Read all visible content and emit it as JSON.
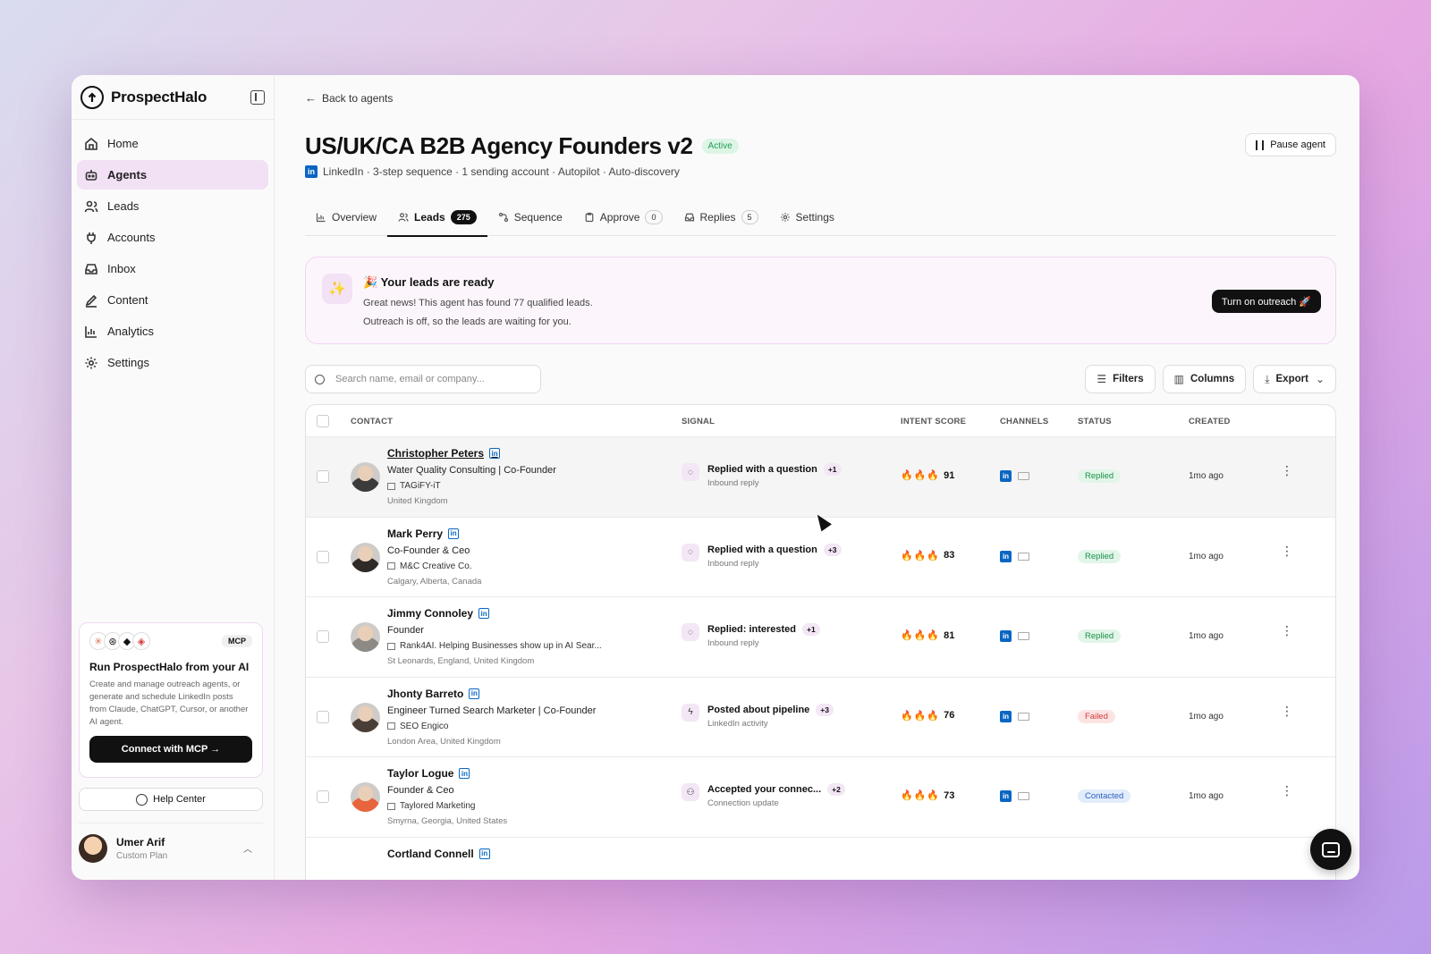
{
  "brand": {
    "name": "ProspectHalo"
  },
  "nav": [
    {
      "label": "Home",
      "icon": "home-icon"
    },
    {
      "label": "Agents",
      "icon": "robot-icon",
      "active": true
    },
    {
      "label": "Leads",
      "icon": "users-icon"
    },
    {
      "label": "Accounts",
      "icon": "plug-icon"
    },
    {
      "label": "Inbox",
      "icon": "inbox-icon"
    },
    {
      "label": "Content",
      "icon": "pen-icon"
    },
    {
      "label": "Analytics",
      "icon": "bar-chart-icon"
    },
    {
      "label": "Settings",
      "icon": "gear-icon"
    }
  ],
  "mcp": {
    "badge": "MCP",
    "title": "Run ProspectHalo from your AI",
    "description": "Create and manage outreach agents, or generate and schedule LinkedIn posts from Claude, ChatGPT, Cursor, or another AI agent.",
    "button": "Connect with MCP →"
  },
  "help": {
    "label": "Help Center"
  },
  "user": {
    "name": "Umer Arif",
    "plan": "Custom Plan"
  },
  "header": {
    "back": "Back to agents",
    "title": "US/UK/CA B2B Agency Founders v2",
    "status": "Active",
    "subtitle": "LinkedIn · 3-step sequence · 1 sending account · Autopilot · Auto-discovery",
    "pause": "Pause agent"
  },
  "tabs": [
    {
      "label": "Overview",
      "icon": "chart-icon",
      "count": null
    },
    {
      "label": "Leads",
      "icon": "users-icon",
      "count": "275",
      "active": true
    },
    {
      "label": "Sequence",
      "icon": "sequence-icon",
      "count": null
    },
    {
      "label": "Approve",
      "icon": "clipboard-icon",
      "count": "0"
    },
    {
      "label": "Replies",
      "icon": "inbox-icon",
      "count": "5"
    },
    {
      "label": "Settings",
      "icon": "gear-icon",
      "count": null
    }
  ],
  "banner": {
    "title": "🎉 Your leads are ready",
    "line1": "Great news! This agent has found 77 qualified leads.",
    "line2": "Outreach is off, so the leads are waiting for you.",
    "button": "Turn on outreach 🚀"
  },
  "toolbar": {
    "search_placeholder": "Search name, email or company...",
    "filters": "Filters",
    "columns": "Columns",
    "export": "Export"
  },
  "columns": {
    "contact": "CONTACT",
    "signal": "SIGNAL",
    "intent": "INTENT SCORE",
    "channels": "CHANNELS",
    "status": "STATUS",
    "created": "CREATED"
  },
  "leads": [
    {
      "name": "Christopher Peters",
      "title": "Water Quality Consulting | Co-Founder",
      "company": "TAGiFY-iT",
      "location": "United Kingdom",
      "signal": "Replied with a question",
      "signal_extra": "+1",
      "signal_sub": "Inbound reply",
      "signal_icon": "chat-icon",
      "flames": 3,
      "score": "91",
      "status": "Replied",
      "status_kind": "replied",
      "created": "1mo ago",
      "avatar": "#3b3b3b"
    },
    {
      "name": "Mark Perry",
      "title": "Co-Founder & Ceo",
      "company": "M&C Creative Co.",
      "location": "Calgary, Alberta, Canada",
      "signal": "Replied with a question",
      "signal_extra": "+3",
      "signal_sub": "Inbound reply",
      "signal_icon": "chat-icon",
      "flames": 3,
      "score": "83",
      "status": "Replied",
      "status_kind": "replied",
      "created": "1mo ago",
      "avatar": "#2e2a28"
    },
    {
      "name": "Jimmy Connoley",
      "title": "Founder",
      "company": "Rank4AI. Helping Businesses show up in AI Sear...",
      "location": "St Leonards, England, United Kingdom",
      "signal": "Replied: interested",
      "signal_extra": "+1",
      "signal_sub": "Inbound reply",
      "signal_icon": "chat-icon",
      "flames": 3,
      "score": "81",
      "status": "Replied",
      "status_kind": "replied",
      "created": "1mo ago",
      "avatar": "#8d8a86"
    },
    {
      "name": "Jhonty Barreto",
      "title": "Engineer Turned Search Marketer | Co-Founder",
      "company": "SEO Engico",
      "location": "London Area, United Kingdom",
      "signal": "Posted about pipeline",
      "signal_extra": "+3",
      "signal_sub": "LinkedIn activity",
      "signal_icon": "bolt-icon",
      "flames": 2,
      "score": "76",
      "status": "Failed",
      "status_kind": "failed",
      "created": "1mo ago",
      "avatar": "#4a3f38"
    },
    {
      "name": "Taylor Logue",
      "title": "Founder & Ceo",
      "company": "Taylored Marketing",
      "location": "Smyrna, Georgia, United States",
      "signal": "Accepted your connec...",
      "signal_extra": "+2",
      "signal_sub": "Connection update",
      "signal_icon": "user-check-icon",
      "flames": 2,
      "score": "73",
      "status": "Contacted",
      "status_kind": "contacted",
      "created": "1mo ago",
      "avatar": "#e8643c"
    }
  ],
  "partial_lead": {
    "name": "Cortland Connell"
  }
}
